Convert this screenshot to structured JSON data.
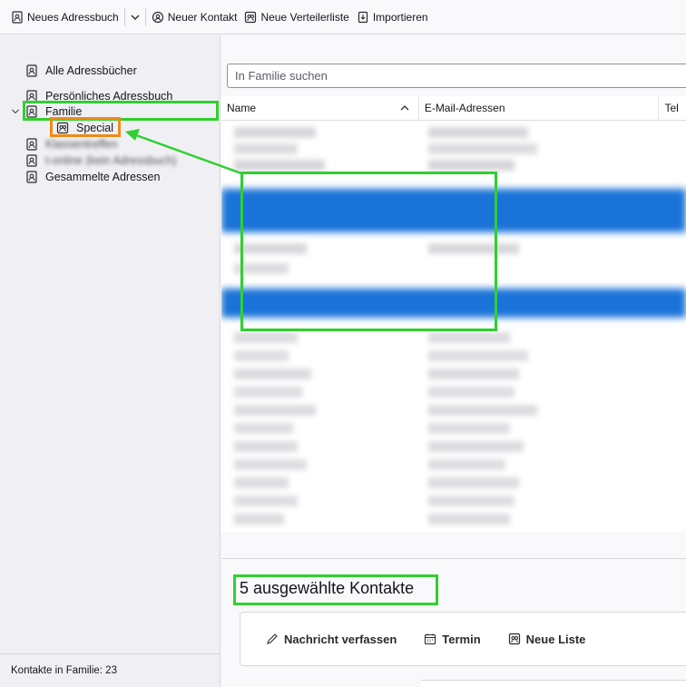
{
  "toolbar": {
    "new_addressbook": "Neues Adressbuch",
    "new_contact": "Neuer Kontakt",
    "new_list": "Neue Verteilerliste",
    "import": "Importieren"
  },
  "sidebar": {
    "items": [
      {
        "label": "Alle Adressbücher"
      },
      {
        "label": "Persönliches Adressbuch"
      },
      {
        "label": "Familie"
      },
      {
        "label": "Special"
      },
      {
        "label": "Klassentreffen"
      },
      {
        "label": "t-online (kein Adressbuch)"
      },
      {
        "label": "Gesammelte Adressen"
      }
    ],
    "status": "Kontakte in Familie: 23"
  },
  "search": {
    "placeholder": "In Familie suchen"
  },
  "columns": [
    "Name",
    "E-Mail-Adressen",
    "Tel"
  ],
  "detail": {
    "selected_title": "5 ausgewählte Kontakte",
    "actions": [
      "Nachricht verfassen",
      "Termin",
      "Neue Liste"
    ]
  },
  "colors": {
    "selection": "#1a73d8",
    "annotation_green": "#2fd02f",
    "annotation_orange": "#f08a16"
  }
}
